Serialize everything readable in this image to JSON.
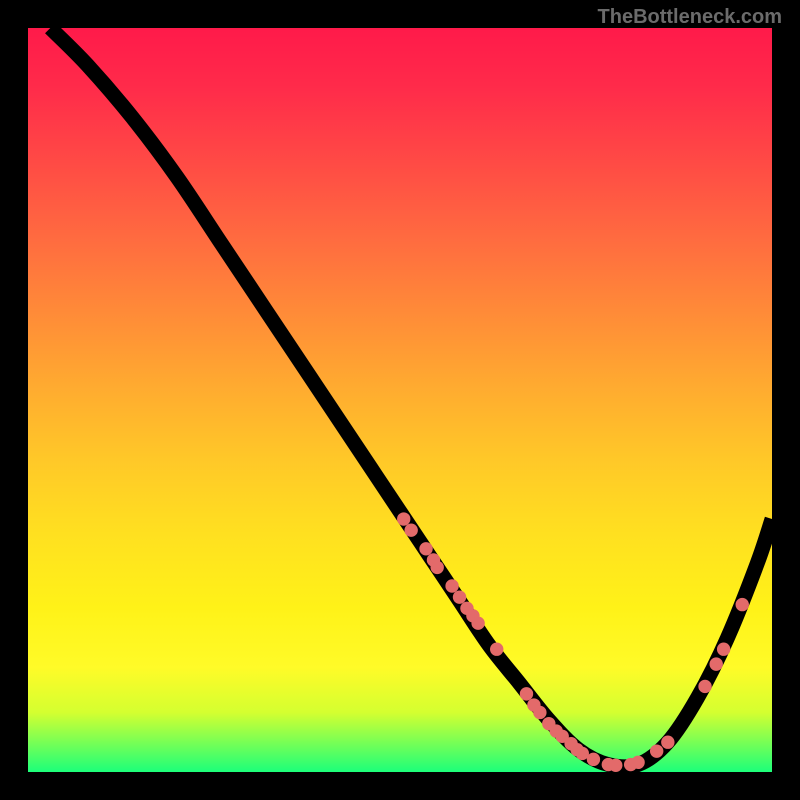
{
  "watermark": "TheBottleneck.com",
  "chart_data": {
    "type": "line",
    "title": "",
    "xlabel": "",
    "ylabel": "",
    "xlim": [
      0,
      100
    ],
    "ylim": [
      0,
      100
    ],
    "grid": false,
    "series": [
      {
        "name": "curve",
        "x": [
          3,
          8,
          14,
          20,
          26,
          32,
          38,
          44,
          50,
          54,
          58,
          62,
          66,
          70,
          74,
          78,
          82,
          86,
          90,
          94,
          98,
          100
        ],
        "y": [
          100,
          95,
          88,
          80,
          71,
          62,
          53,
          44,
          35,
          29,
          23,
          17,
          12,
          7,
          3,
          1,
          1,
          4,
          10,
          18,
          28,
          34
        ]
      }
    ],
    "markers": [
      {
        "x": 50.5,
        "y": 34
      },
      {
        "x": 51.5,
        "y": 32.5
      },
      {
        "x": 53.5,
        "y": 30
      },
      {
        "x": 54.5,
        "y": 28.5
      },
      {
        "x": 55.0,
        "y": 27.5
      },
      {
        "x": 57.0,
        "y": 25
      },
      {
        "x": 58.0,
        "y": 23.5
      },
      {
        "x": 59.0,
        "y": 22
      },
      {
        "x": 59.8,
        "y": 21
      },
      {
        "x": 60.5,
        "y": 20
      },
      {
        "x": 63.0,
        "y": 16.5
      },
      {
        "x": 67.0,
        "y": 10.5
      },
      {
        "x": 68.0,
        "y": 9
      },
      {
        "x": 68.8,
        "y": 8
      },
      {
        "x": 70.0,
        "y": 6.5
      },
      {
        "x": 71.0,
        "y": 5.5
      },
      {
        "x": 71.8,
        "y": 4.8
      },
      {
        "x": 73.0,
        "y": 3.8
      },
      {
        "x": 73.8,
        "y": 3.0
      },
      {
        "x": 74.5,
        "y": 2.5
      },
      {
        "x": 76.0,
        "y": 1.7
      },
      {
        "x": 78.0,
        "y": 1.0
      },
      {
        "x": 79.0,
        "y": 0.9
      },
      {
        "x": 81.0,
        "y": 1.0
      },
      {
        "x": 82.0,
        "y": 1.3
      },
      {
        "x": 84.5,
        "y": 2.8
      },
      {
        "x": 86.0,
        "y": 4.0
      },
      {
        "x": 91.0,
        "y": 11.5
      },
      {
        "x": 92.5,
        "y": 14.5
      },
      {
        "x": 93.5,
        "y": 16.5
      },
      {
        "x": 96.0,
        "y": 22.5
      }
    ]
  }
}
